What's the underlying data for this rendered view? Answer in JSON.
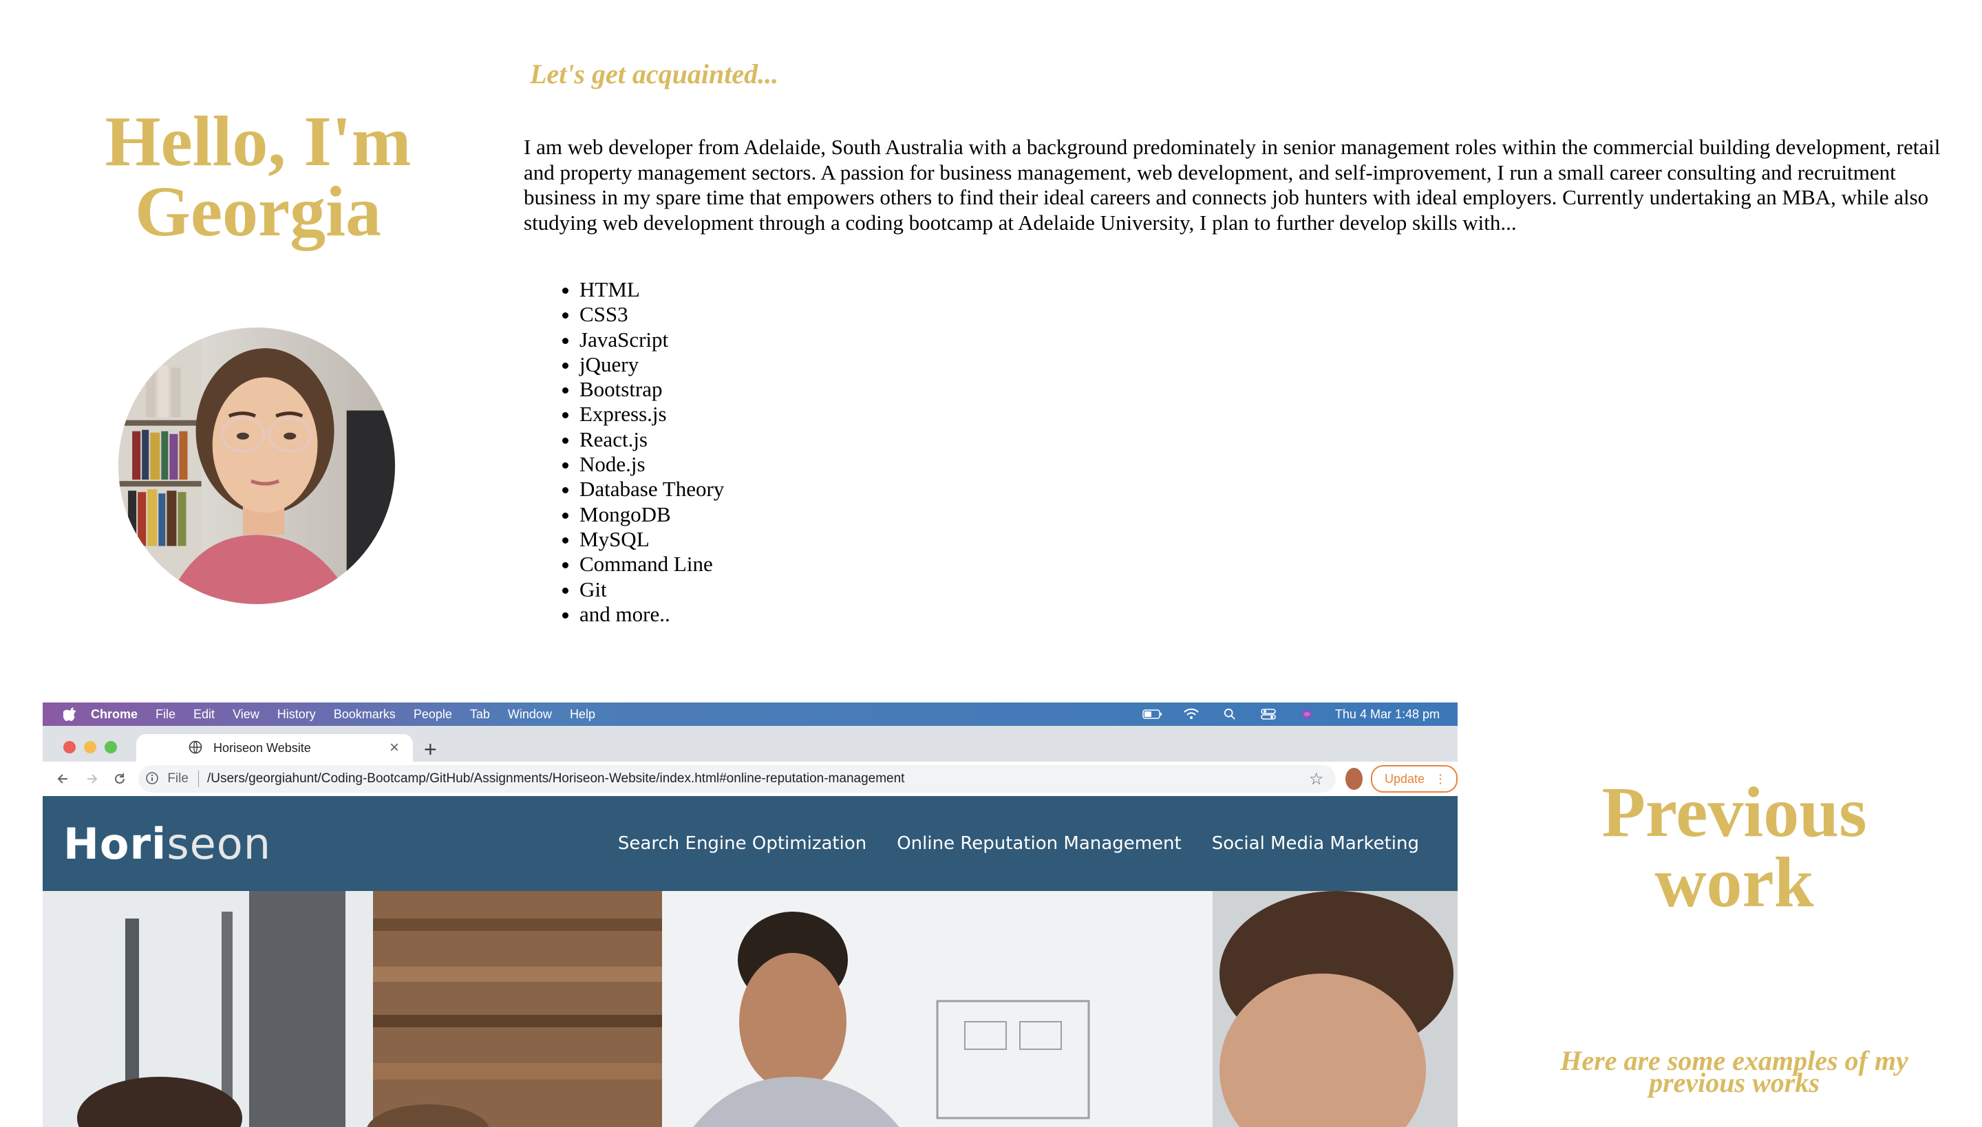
{
  "hero": {
    "greeting_line1": "Hello, I'm",
    "greeting_line2": "Georgia",
    "photo_alt": "Portrait of Georgia"
  },
  "about": {
    "heading": "Let's get acquainted...",
    "intro": "I am web developer from Adelaide, South Australia with a background predominately in senior management roles within the commercial building development, retail and property management sectors. A passion for business management, web development, and self-improvement, I run a small career consulting and recruitment business in my spare time that empowers others to find their ideal careers and connects job hunters with ideal employers. Currently undertaking an MBA, while also studying web development through a coding bootcamp at Adelaide University, I plan to further develop skills with...",
    "skills": [
      "HTML",
      "CSS3",
      "JavaScript",
      "jQuery",
      "Bootstrap",
      "Express.js",
      "React.js",
      "Node.js",
      "Database Theory",
      "MongoDB",
      "MySQL",
      "Command Line",
      "Git",
      "and more.."
    ]
  },
  "screenshot": {
    "menubar": {
      "app": "Chrome",
      "items": [
        "File",
        "Edit",
        "View",
        "History",
        "Bookmarks",
        "People",
        "Tab",
        "Window",
        "Help"
      ],
      "clock": "Thu 4 Mar  1:48 pm"
    },
    "tab_title": "Horiseon Website",
    "url_scheme": "File",
    "url": "/Users/georgiahunt/Coding-Bootcamp/GitHub/Assignments/Horiseon-Website/index.html#online-reputation-management",
    "update_label": "Update",
    "site": {
      "logo_bold": "Hori",
      "logo_light": "seon",
      "nav": [
        "Search Engine Optimization",
        "Online Reputation Management",
        "Social Media Marketing"
      ]
    }
  },
  "previous_work": {
    "heading_line1": "Previous",
    "heading_line2": "work",
    "subtitle_line1": "Here are some examples of my",
    "subtitle_line2": "previous works"
  },
  "colors": {
    "accent_gold": "#d9ba61",
    "site_header": "#305a78",
    "update_orange": "#e8833a"
  }
}
